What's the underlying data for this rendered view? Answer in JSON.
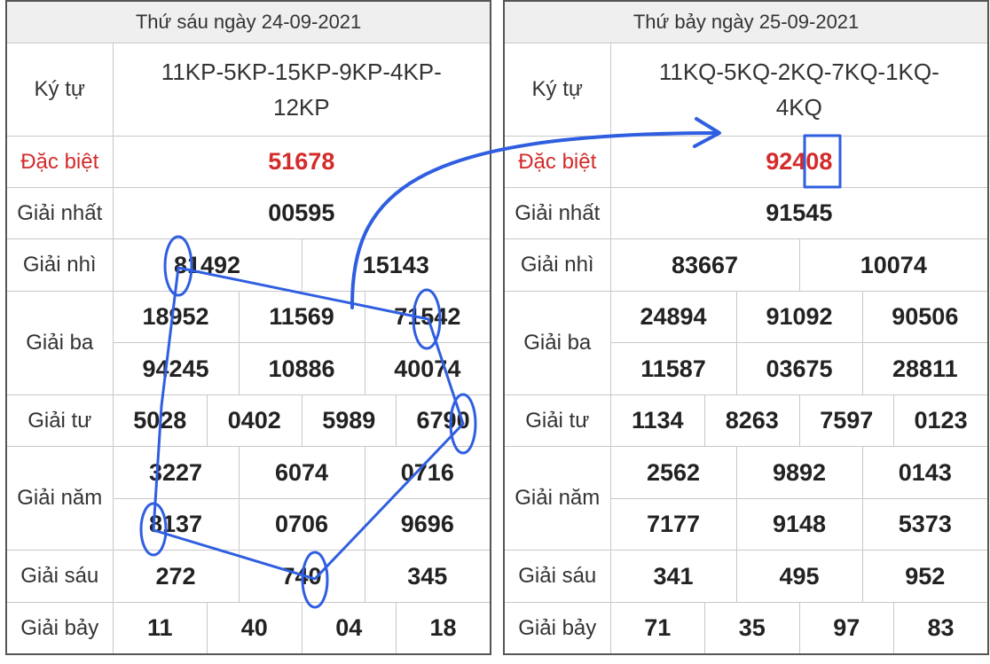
{
  "left": {
    "header": "Thứ sáu ngày 24-09-2021",
    "labels": {
      "ky_tu": "Ký tự",
      "dac_biet": "Đặc biệt",
      "giai_nhat": "Giải nhất",
      "giai_nhi": "Giải nhì",
      "giai_ba": "Giải ba",
      "giai_tu": "Giải tư",
      "giai_nam": "Giải năm",
      "giai_sau": "Giải sáu",
      "giai_bay": "Giải bảy"
    },
    "ky_tu": [
      "11KP-5KP-15KP-9KP-4KP-",
      "12KP"
    ],
    "dac_biet": "51678",
    "giai_nhat": "00595",
    "giai_nhi": [
      "81492",
      "15143"
    ],
    "giai_ba": [
      "18952",
      "11569",
      "71542",
      "94245",
      "10886",
      "40074"
    ],
    "giai_tu": [
      "5028",
      "0402",
      "5989",
      "6790"
    ],
    "giai_nam": [
      "3227",
      "6074",
      "0716",
      "8137",
      "0706",
      "9696"
    ],
    "giai_sau": [
      "272",
      "740",
      "345"
    ],
    "giai_bay": [
      "11",
      "40",
      "04",
      "18"
    ]
  },
  "right": {
    "header": "Thứ bảy ngày 25-09-2021",
    "labels": {
      "ky_tu": "Ký tự",
      "dac_biet": "Đặc biệt",
      "giai_nhat": "Giải nhất",
      "giai_nhi": "Giải nhì",
      "giai_ba": "Giải ba",
      "giai_tu": "Giải tư",
      "giai_nam": "Giải năm",
      "giai_sau": "Giải sáu",
      "giai_bay": "Giải bảy"
    },
    "ky_tu": [
      "11KQ-5KQ-2KQ-7KQ-1KQ-",
      "4KQ"
    ],
    "dac_biet": "92408",
    "giai_nhat": "91545",
    "giai_nhi": [
      "83667",
      "10074"
    ],
    "giai_ba": [
      "24894",
      "91092",
      "90506",
      "11587",
      "03675",
      "28811"
    ],
    "giai_tu": [
      "1134",
      "8263",
      "7597",
      "0123"
    ],
    "giai_nam": [
      "2562",
      "9892",
      "0143",
      "7177",
      "9148",
      "5373"
    ],
    "giai_sau": [
      "341",
      "495",
      "952"
    ],
    "giai_bay": [
      "71",
      "35",
      "97",
      "83"
    ]
  },
  "colors": {
    "annotation": "#2f5ee0",
    "special": "#d42b2b",
    "header_bg": "#efefef"
  }
}
